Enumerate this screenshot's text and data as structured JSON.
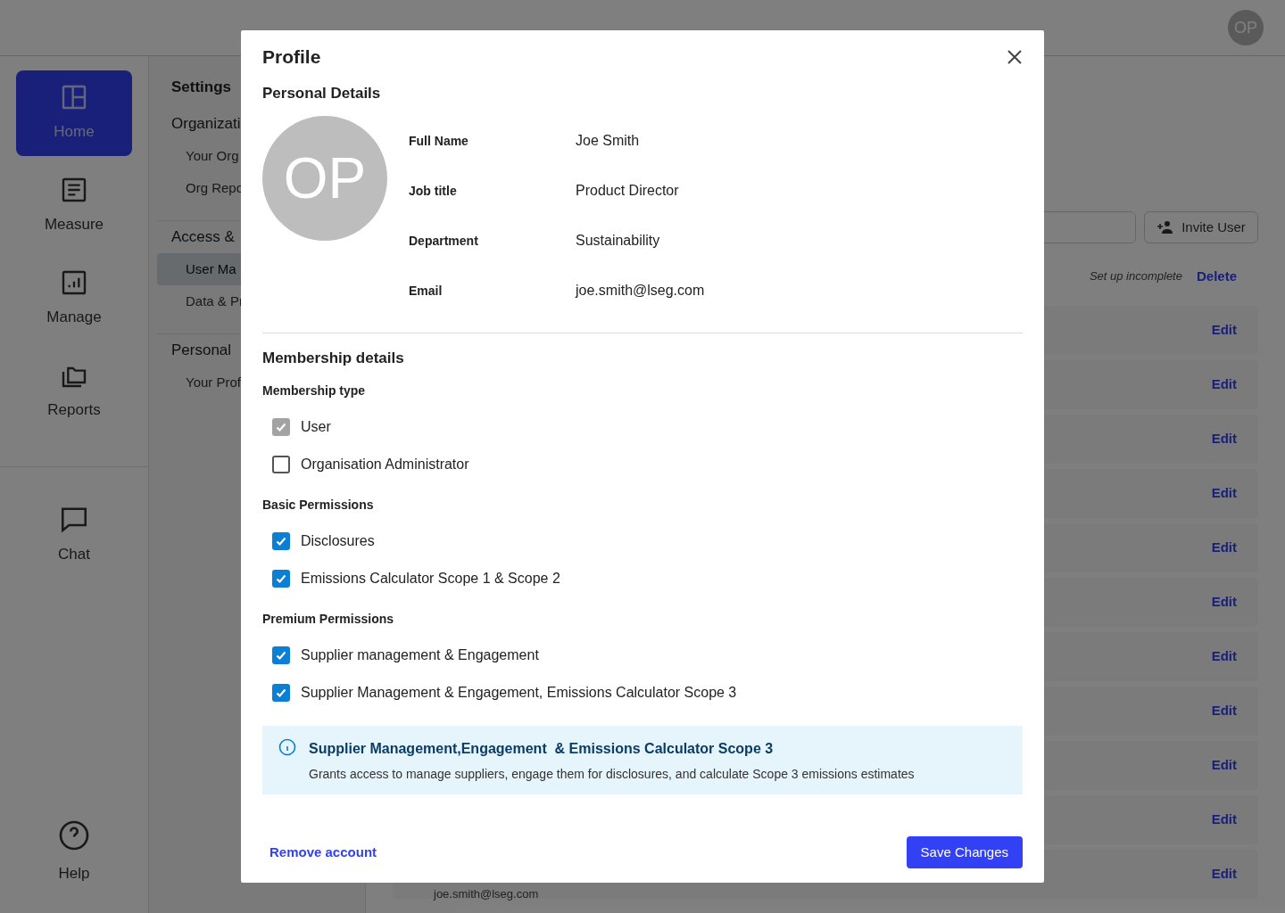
{
  "header": {
    "avatar": "OP"
  },
  "nav": {
    "items": [
      {
        "label": "Home",
        "selected": true
      },
      {
        "label": "Measure",
        "selected": false
      },
      {
        "label": "Manage",
        "selected": false
      },
      {
        "label": "Reports",
        "selected": false
      }
    ],
    "lower_items": [
      {
        "label": "Chat",
        "selected": false
      }
    ],
    "help": {
      "label": "Help"
    }
  },
  "settings": {
    "title": "Settings",
    "groups": [
      {
        "label": "Organizati",
        "items": [
          {
            "label": "Your Org",
            "selected": false
          },
          {
            "label": "Org Repo",
            "selected": false
          }
        ]
      },
      {
        "label": "Access &",
        "items": [
          {
            "label": "User Ma",
            "selected": true
          },
          {
            "label": "Data & Pr",
            "selected": false
          }
        ]
      },
      {
        "label": "Personal",
        "items": [
          {
            "label": "Your Prof",
            "selected": false
          }
        ]
      }
    ]
  },
  "main": {
    "invite_button": "Invite User",
    "status": "Set up incomplete",
    "delete_link": "Delete",
    "rows": [
      {
        "action": "Edit"
      },
      {
        "action": "Edit"
      },
      {
        "action": "Edit"
      },
      {
        "action": "Edit"
      },
      {
        "action": "Edit"
      },
      {
        "action": "Edit"
      },
      {
        "action": "Edit"
      },
      {
        "action": "Edit"
      },
      {
        "action": "Edit"
      },
      {
        "action": "Edit"
      },
      {
        "action": "Edit",
        "email": "joe.smith@lseg.com"
      }
    ]
  },
  "modal": {
    "title": "Profile",
    "personal_heading": "Personal Details",
    "avatar": "OP",
    "fields": [
      {
        "label": "Full Name",
        "value": "Joe Smith"
      },
      {
        "label": "Job title",
        "value": "Product Director"
      },
      {
        "label": "Department",
        "value": "Sustainability"
      },
      {
        "label": "Email",
        "value": "joe.smith@lseg.com"
      }
    ],
    "membership_heading": "Membership details",
    "groups": [
      {
        "title": "Membership type",
        "options": [
          {
            "label": "User",
            "checked": true,
            "disabled": true
          },
          {
            "label": "Organisation Administrator",
            "checked": false,
            "disabled": false
          }
        ]
      },
      {
        "title": "Basic Permissions",
        "options": [
          {
            "label": "Disclosures",
            "checked": true,
            "disabled": false
          },
          {
            "label": "Emissions Calculator Scope 1 & Scope 2",
            "checked": true,
            "disabled": false
          }
        ]
      },
      {
        "title": "Premium Permissions",
        "options": [
          {
            "label": "Supplier management & Engagement",
            "checked": true,
            "disabled": false
          },
          {
            "label": "Supplier Management & Engagement, Emissions Calculator Scope 3",
            "checked": true,
            "disabled": false
          }
        ]
      }
    ],
    "info": {
      "title": "Supplier Management,Engagement  & Emissions Calculator Scope 3",
      "text": "Grants access to manage suppliers, engage them for disclosures, and calculate Scope 3 emissions estimates"
    },
    "remove_link": "Remove account",
    "save_button": "Save Changes"
  }
}
